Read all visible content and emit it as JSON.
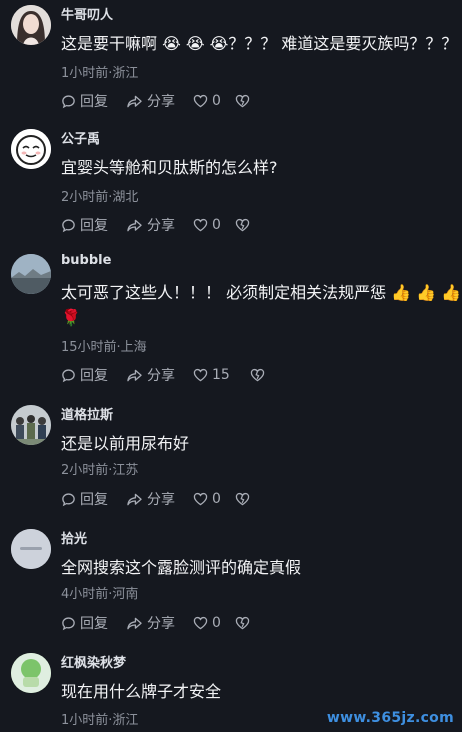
{
  "comments": [
    {
      "username": "牛哥叨人",
      "text": "这是要干嘛啊 😭 😭 😭？？？ 难道这是要灭族吗？？？",
      "meta": "1小时前·浙江",
      "reply_label": "回复",
      "share_label": "分享",
      "likes": "0",
      "avatar_color": "#d9d4d0"
    },
    {
      "username": "公子禹",
      "text": "宜婴头等舱和贝肽斯的怎么样?",
      "meta": "2小时前·湖北",
      "reply_label": "回复",
      "share_label": "分享",
      "likes": "0",
      "avatar_color": "#ffffff"
    },
    {
      "username": "bubble",
      "text": "太可恶了这些人！！！ 必须制定相关法规严惩 👍 👍 👍",
      "text_line2": "🌹",
      "meta": "15小时前·上海",
      "reply_label": "回复",
      "share_label": "分享",
      "likes": "15",
      "avatar_color": "#8fa3b5"
    },
    {
      "username": "道格拉斯",
      "text": "还是以前用尿布好",
      "meta": "2小时前·江苏",
      "reply_label": "回复",
      "share_label": "分享",
      "likes": "0",
      "avatar_color": "#6f7b83"
    },
    {
      "username": "拾光",
      "text": "全网搜索这个露脸测评的确定真假",
      "meta": "4小时前·河南",
      "reply_label": "回复",
      "share_label": "分享",
      "likes": "0",
      "avatar_color": "#c7ccd6"
    },
    {
      "username": "红枫染秋梦",
      "text": "现在用什么牌子才安全",
      "meta": "1小时前·浙江",
      "avatar_color": "#9fcf8a"
    }
  ],
  "watermark": "www.365jz.com",
  "colors": {
    "background": "#15181f",
    "meta_text": "#8c919b",
    "action_text": "#a9adb6",
    "watermark": "#3e8fe0"
  },
  "icons": {
    "reply": "speech-bubble-icon",
    "share": "share-arrow-icon",
    "like": "heart-icon",
    "dislike": "broken-heart-icon"
  }
}
